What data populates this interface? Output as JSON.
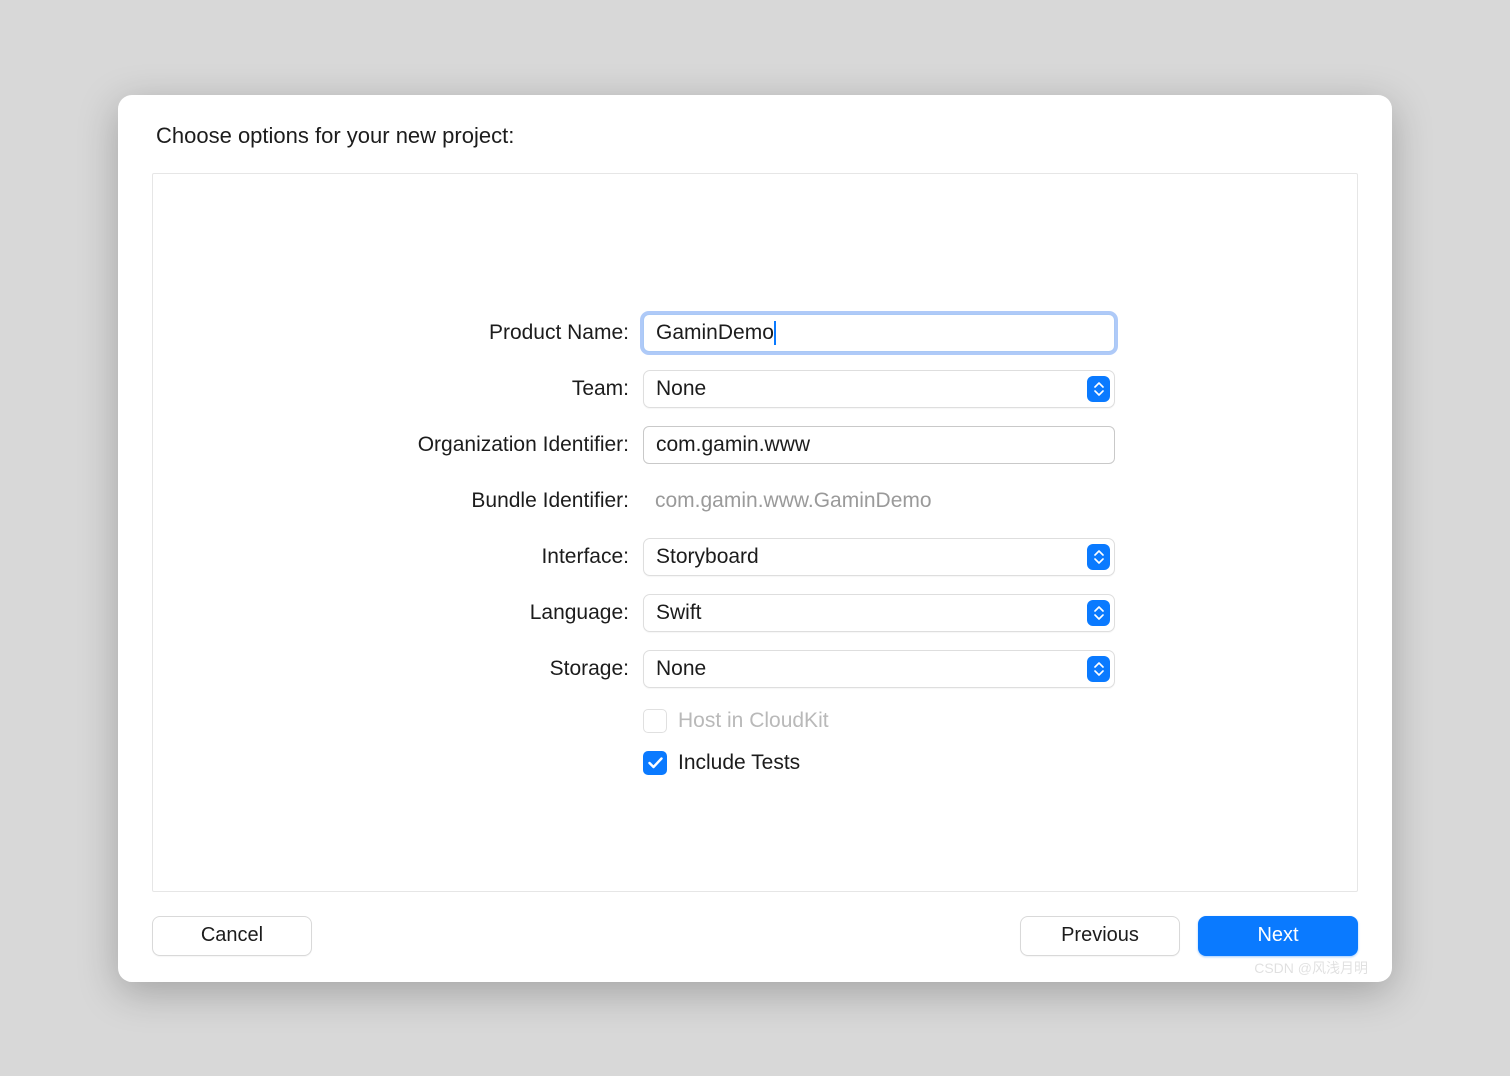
{
  "dialog": {
    "title": "Choose options for your new project:"
  },
  "form": {
    "product_name": {
      "label": "Product Name:",
      "value": "GaminDemo"
    },
    "team": {
      "label": "Team:",
      "value": "None"
    },
    "org_identifier": {
      "label": "Organization Identifier:",
      "value": "com.gamin.www"
    },
    "bundle_identifier": {
      "label": "Bundle Identifier:",
      "value": "com.gamin.www.GaminDemo"
    },
    "interface": {
      "label": "Interface:",
      "value": "Storyboard"
    },
    "language": {
      "label": "Language:",
      "value": "Swift"
    },
    "storage": {
      "label": "Storage:",
      "value": "None"
    },
    "host_cloudkit": {
      "label": "Host in CloudKit",
      "checked": false,
      "disabled": true
    },
    "include_tests": {
      "label": "Include Tests",
      "checked": true,
      "disabled": false
    }
  },
  "buttons": {
    "cancel": "Cancel",
    "previous": "Previous",
    "next": "Next"
  },
  "watermark": "CSDN @风浅月明"
}
